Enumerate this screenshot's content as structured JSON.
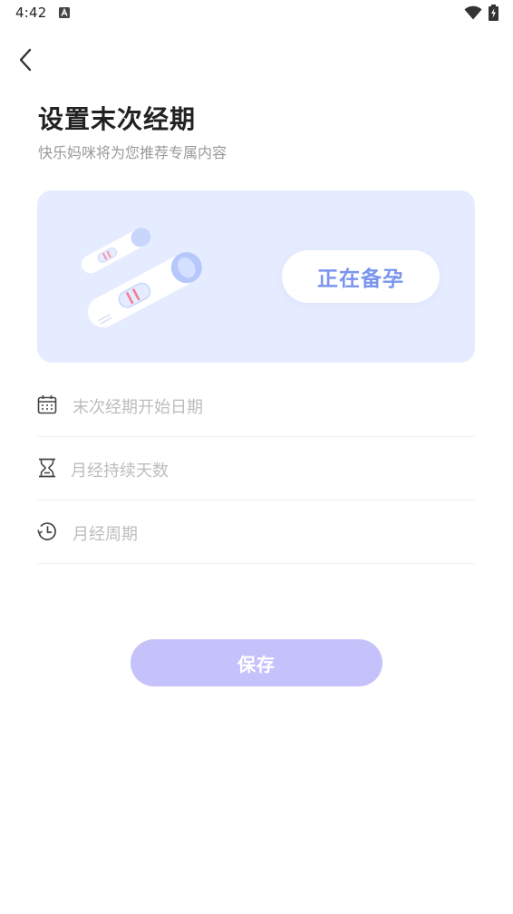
{
  "status_bar": {
    "time": "4:42",
    "icons": [
      "a-notification-icon",
      "wifi-icon",
      "battery-charging-icon"
    ]
  },
  "header": {
    "back_icon": "back-arrow-icon",
    "title": "设置末次经期",
    "subtitle": "快乐妈咪将为您推荐专属内容"
  },
  "banner": {
    "illustration": "pregnancy-test-sticks",
    "status_label": "正在备孕",
    "background_color": "#e6ecff",
    "accent_color": "#7b95ef"
  },
  "form": {
    "fields": [
      {
        "icon": "calendar-icon",
        "placeholder": "末次经期开始日期",
        "value": ""
      },
      {
        "icon": "hourglass-icon",
        "placeholder": "月经持续天数",
        "value": ""
      },
      {
        "icon": "clock-icon",
        "placeholder": "月经周期",
        "value": ""
      }
    ]
  },
  "actions": {
    "save_label": "保存",
    "save_color": "#c5c2fb"
  }
}
